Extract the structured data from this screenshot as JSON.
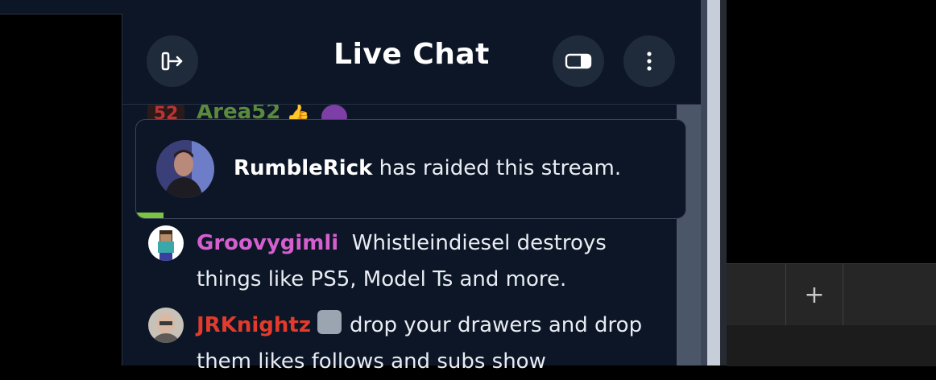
{
  "header": {
    "title": "Live Chat",
    "exit_icon": "exit-icon",
    "mode_icon": "toggle-mode-icon",
    "more_icon": "more-vertical-icon"
  },
  "peek_message": {
    "badge": "52",
    "username": "Area52",
    "emoji": "👍",
    "username_color": "#5b8a3e"
  },
  "raid": {
    "raider": "RumbleRick",
    "text": " has raided this stream.",
    "progress": 0.05,
    "progress_color": "#7cc243"
  },
  "messages": [
    {
      "username": "Groovygimli",
      "username_color": "#d65fcf",
      "text": "Whistleindiesel destroys things like PS5, Model Ts and more."
    },
    {
      "username": "JRKnightz",
      "username_color": "#e23b2b",
      "badge_icon": "subscriber-badge-icon",
      "text": "drop your drawers and drop them likes follows and subs show"
    }
  ],
  "browser": {
    "new_tab_label": "+"
  }
}
